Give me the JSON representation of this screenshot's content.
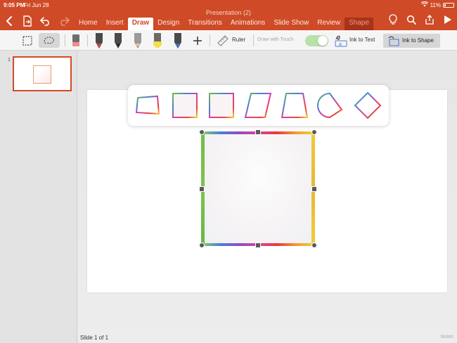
{
  "status_bar": {
    "time": "9:05 PM",
    "date": "Fri Jun 28",
    "battery": "11%"
  },
  "document": {
    "title": "Presentation (2)"
  },
  "tabs": [
    {
      "label": "Home"
    },
    {
      "label": "Insert"
    },
    {
      "label": "Draw"
    },
    {
      "label": "Design"
    },
    {
      "label": "Transitions"
    },
    {
      "label": "Animations"
    },
    {
      "label": "Slide Show"
    },
    {
      "label": "Review"
    },
    {
      "label": "Shape"
    }
  ],
  "toolbar": {
    "ruler_label": "Ruler",
    "draw_with_touch_label": "Draw with Touch",
    "draw_with_touch_on": true,
    "ink_to_text_label": "Ink to Text",
    "ink_to_shape_label": "Ink to Shape",
    "pen_colors": [
      "#e23b3b",
      "#3a3a3a",
      "#d04a2a",
      "#f0e04a",
      "#4a6ad0"
    ]
  },
  "slides": {
    "thumbnail_number": "1"
  },
  "status": {
    "slide_counter": "Slide 1 of 1",
    "notes_label": "Notes"
  },
  "shape_suggestions": [
    "irregular-quad",
    "square",
    "square-alt",
    "parallelogram",
    "trapezoid",
    "semicircle-wedge",
    "diamond"
  ],
  "colors": {
    "ribbon": "#cf4a26",
    "selection_handle": "#5a5a5a"
  }
}
